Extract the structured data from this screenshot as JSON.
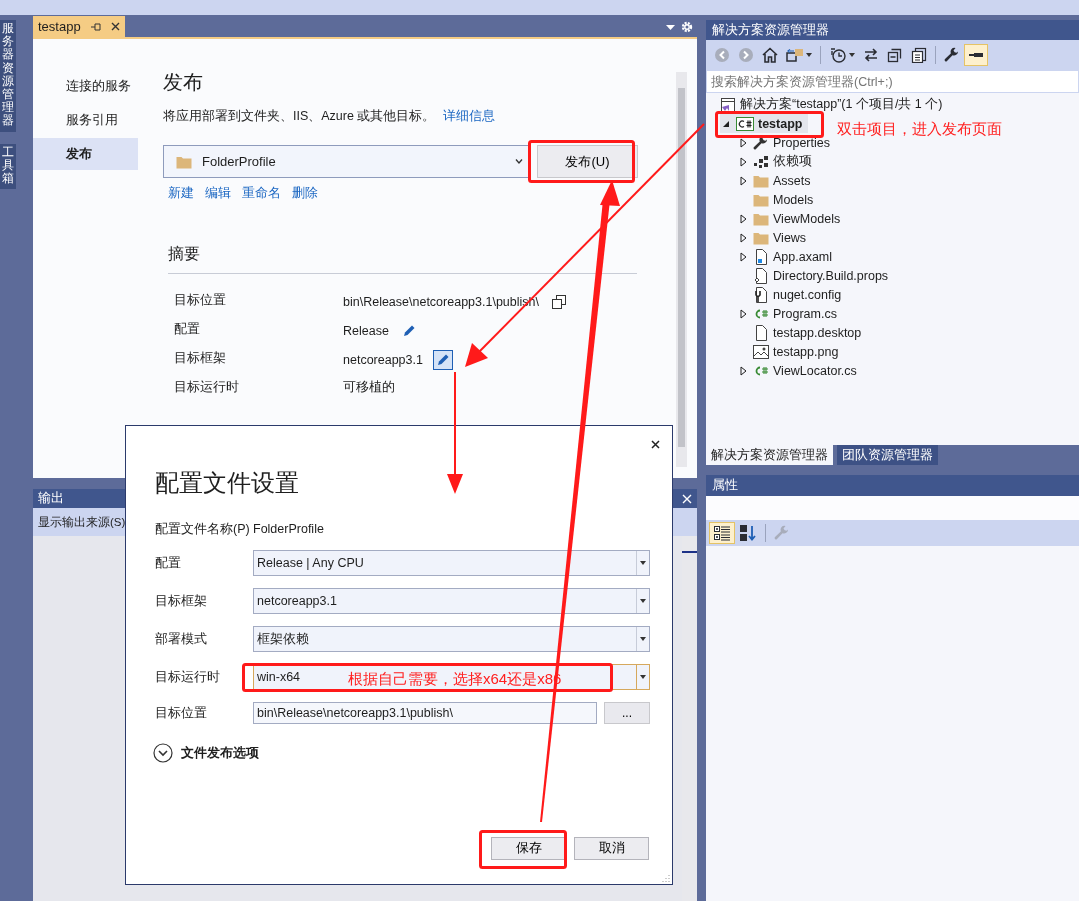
{
  "side_tabs": [
    {
      "label": "服务器资源管理器"
    },
    {
      "label": "工具箱"
    }
  ],
  "document": {
    "tab": {
      "title": "testapp",
      "selected": true
    },
    "nav": [
      {
        "label": "连接的服务",
        "selected": false
      },
      {
        "label": "服务引用",
        "selected": false
      },
      {
        "label": "发布",
        "selected": true
      }
    ],
    "heading": "发布",
    "description": "将应用部署到文件夹、IIS、Azure 或其他目标。",
    "link": "详细信息",
    "profile": "FolderProfile",
    "publish_button": "发布(U)",
    "actions": [
      "新建",
      "编辑",
      "重命名",
      "删除"
    ],
    "summary_title": "摘要",
    "summary": [
      {
        "label": "目标位置",
        "value": "bin\\Release\\netcoreapp3.1\\publish\\",
        "kind": "copy",
        "hover": false
      },
      {
        "label": "配置",
        "value": "Release",
        "kind": "edit",
        "hover": false
      },
      {
        "label": "目标框架",
        "value": "netcoreapp3.1",
        "kind": "edit",
        "hover": true
      },
      {
        "label": "目标运行时",
        "value": "可移植的",
        "kind": "plain"
      }
    ]
  },
  "output": {
    "title": "输出",
    "source_label": "显示输出来源(S)"
  },
  "explorer": {
    "title": "解决方案资源管理器",
    "toolbar": [
      [
        {
          "kind": "back",
          "disabled": true,
          "selected": false,
          "dropdown": false
        },
        {
          "kind": "forward",
          "disabled": true,
          "selected": false,
          "dropdown": false
        },
        {
          "kind": "home",
          "disabled": false,
          "selected": false,
          "dropdown": false
        },
        {
          "kind": "switch-views",
          "disabled": false,
          "selected": false,
          "dropdown": true
        }
      ],
      [
        {
          "kind": "history",
          "disabled": false,
          "selected": false,
          "dropdown": true
        },
        {
          "kind": "sync",
          "disabled": false,
          "selected": false,
          "dropdown": false
        },
        {
          "kind": "collapse-all",
          "disabled": false,
          "selected": false,
          "dropdown": false
        },
        {
          "kind": "show-all",
          "disabled": false,
          "selected": false,
          "dropdown": false
        }
      ],
      [
        {
          "kind": "properties",
          "disabled": false,
          "selected": false,
          "dropdown": false
        },
        {
          "kind": "preview",
          "disabled": false,
          "selected": true,
          "dropdown": false
        }
      ]
    ],
    "search_placeholder": "搜索解决方案资源管理器(Ctrl+;)",
    "tree": [
      {
        "label": "解决方案“testapp”(1 个项目/共 1 个)",
        "kind": "solution",
        "selected": false,
        "children": [
          {
            "label": "testapp",
            "kind": "project",
            "selected": true,
            "expanded": true,
            "children": [
              {
                "label": "Properties",
                "kind": "wrench",
                "selected": false,
                "expanded": false
              },
              {
                "label": "依赖项",
                "kind": "dependencies",
                "selected": false,
                "expanded": false
              },
              {
                "label": "Assets",
                "kind": "folder",
                "selected": false,
                "expanded": false
              },
              {
                "label": "Models",
                "kind": "folder",
                "selected": false
              },
              {
                "label": "ViewModels",
                "kind": "folder",
                "selected": false,
                "expanded": false
              },
              {
                "label": "Views",
                "kind": "folder",
                "selected": false,
                "expanded": false
              },
              {
                "label": "App.axaml",
                "kind": "markup",
                "selected": false,
                "expanded": false
              },
              {
                "label": "Directory.Build.props",
                "kind": "props",
                "selected": false
              },
              {
                "label": "nuget.config",
                "kind": "config",
                "selected": false
              },
              {
                "label": "Program.cs",
                "kind": "code",
                "selected": false,
                "expanded": false
              },
              {
                "label": "testapp.desktop",
                "kind": "file",
                "selected": false
              },
              {
                "label": "testapp.png",
                "kind": "image",
                "selected": false
              },
              {
                "label": "ViewLocator.cs",
                "kind": "code",
                "selected": false,
                "expanded": false
              }
            ]
          }
        ]
      }
    ],
    "bottom_tabs": [
      {
        "label": "解决方案资源管理器",
        "selected": true
      },
      {
        "label": "团队资源管理器",
        "selected": false
      }
    ]
  },
  "properties": {
    "title": "属性",
    "toolbar": [
      [
        {
          "kind": "categorized",
          "disabled": false,
          "selected": true,
          "dropdown": false
        },
        {
          "kind": "alphabetical",
          "disabled": false,
          "selected": false,
          "dropdown": false
        }
      ],
      [
        {
          "kind": "property-pages",
          "disabled": true,
          "selected": false,
          "dropdown": false
        }
      ]
    ]
  },
  "dialog": {
    "title": "配置文件设置",
    "profile_label": "配置文件名称(P)",
    "profile_name": "FolderProfile",
    "fields": [
      {
        "label": "配置",
        "value": "Release | Any CPU",
        "kind": "dropdown",
        "focused": false
      },
      {
        "label": "目标框架",
        "value": "netcoreapp3.1",
        "kind": "dropdown",
        "focused": false
      },
      {
        "label": "部署模式",
        "value": "框架依赖",
        "kind": "dropdown",
        "focused": false
      },
      {
        "label": "目标运行时",
        "value": "win-x64",
        "kind": "dropdown",
        "focused": true
      },
      {
        "label": "目标位置",
        "value": "bin\\Release\\netcoreapp3.1\\publish\\",
        "kind": "browse",
        "focused": false,
        "button": "..."
      }
    ],
    "expander": {
      "label": "文件发布选项",
      "expanded": false
    },
    "buttons": [
      "保存",
      "取消"
    ]
  },
  "annotations": [
    {
      "kind": "note",
      "text": "双击项目，进入发布页面"
    },
    {
      "kind": "note",
      "text": "根据自己需要，选择x64还是x86"
    }
  ]
}
